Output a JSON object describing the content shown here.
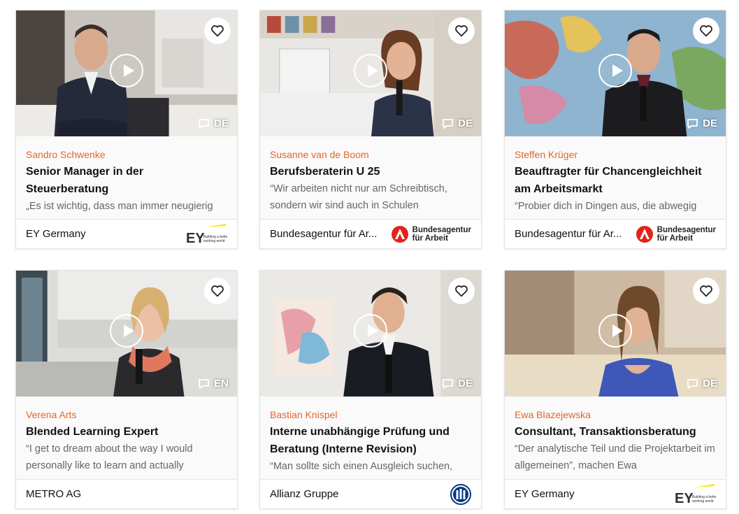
{
  "colors": {
    "accent": "#e2662c",
    "ba_red": "#e2231a",
    "ey_yellow": "#ffe600",
    "allianz_blue": "#003781"
  },
  "cards": [
    {
      "name": "Sandro Schwenke",
      "title": "Senior Manager in der Steuerberatung",
      "quote": "„Es ist wichtig, dass man immer neugierig",
      "language": "DE",
      "company": "EY Germany",
      "logo": "ey-logo",
      "logo_tagline": "Building a better working world",
      "logo_mark": "EY"
    },
    {
      "name": "Susanne van de Boom",
      "title": "Berufsberaterin U 25",
      "quote": "“Wir arbeiten nicht nur am Schreibtisch, sondern wir sind auch in Schulen",
      "language": "DE",
      "company": "Bundesagentur für Ar...",
      "logo": "ba-logo",
      "logo_text_1": "Bundesagentur",
      "logo_text_2": "für Arbeit"
    },
    {
      "name": "Steffen Krüger",
      "title": "Beauftragter für Chancengleichheit am Arbeitsmarkt",
      "quote": "“Probier dich in Dingen aus, die abwegig",
      "language": "DE",
      "company": "Bundesagentur für Ar...",
      "logo": "ba-logo",
      "logo_text_1": "Bundesagentur",
      "logo_text_2": "für Arbeit"
    },
    {
      "name": "Verena Arts",
      "title": "Blended Learning Expert",
      "quote": "“I get to dream about the way I would personally like to learn and actually",
      "language": "EN",
      "company": "METRO AG",
      "logo": "none"
    },
    {
      "name": "Bastian Knispel",
      "title": "Interne unabhängige Prüfung und Beratung (Interne Revision)",
      "quote": "“Man sollte sich einen Ausgleich suchen,",
      "language": "DE",
      "company": "Allianz Gruppe",
      "logo": "allianz-logo"
    },
    {
      "name": "Ewa Blazejewska",
      "title": "Consultant, Transaktionsberatung",
      "quote": "“Der analytische Teil und die Projektarbeit im allgemeinen”, machen Ewa",
      "language": "DE",
      "company": "EY Germany",
      "logo": "ey-logo",
      "logo_tagline": "Building a better working world",
      "logo_mark": "EY"
    }
  ]
}
